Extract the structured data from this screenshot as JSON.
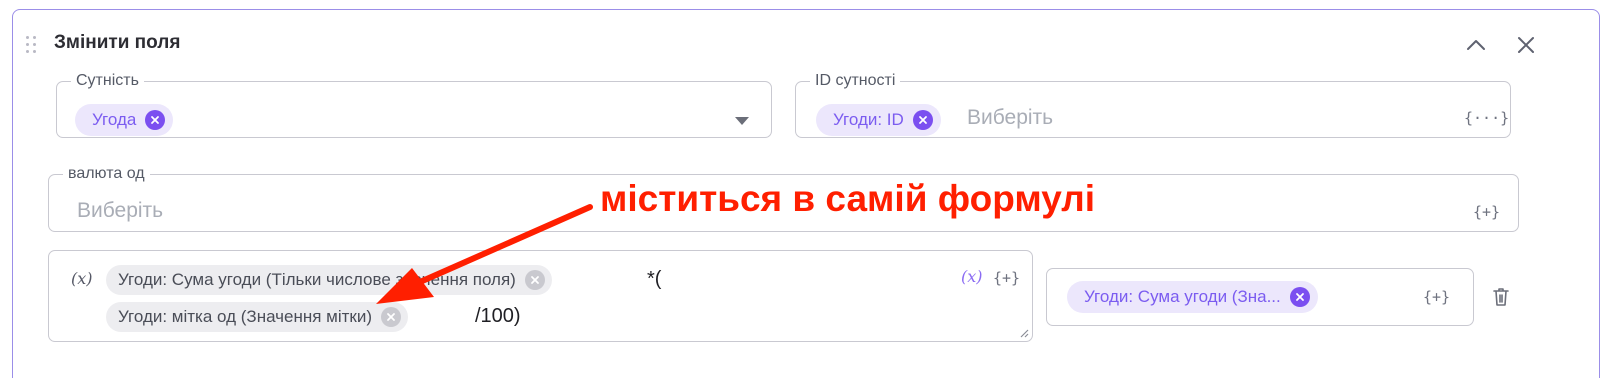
{
  "panel": {
    "title": "Змінити поля",
    "collapse_icon": "chevron-up-icon",
    "close_icon": "close-icon",
    "drag_icon": "drag-handle-icon"
  },
  "entity_field": {
    "label": "Сутність",
    "chip": "Угода",
    "dropdown_icon": "caret-down-icon"
  },
  "entity_id_field": {
    "label": "ID сутності",
    "chip": "Угоди: ID",
    "placeholder": "Виберіть",
    "insert_label": "{···}"
  },
  "currency_field": {
    "label": "валюта од",
    "placeholder": "Виберіть",
    "insert_label": "{+}"
  },
  "formula": {
    "fx_label": "(x)",
    "chip1": "Угоди: Сума угоди (Тільки числове значення поля)",
    "op1": "*(",
    "chip2": "Угоди: мітка од (Значення мітки)",
    "op2": "/100)",
    "fx_button": "(x)",
    "insert_label": "{+}"
  },
  "target_field": {
    "chip": "Угоди: Сума угоди (Зна...",
    "insert_label": "{+}",
    "delete_icon": "trash-icon"
  },
  "annotation": {
    "text": "міститься в самій формулі",
    "color": "#ff1f00"
  },
  "colors": {
    "accent": "#7b4ff0",
    "chip_bg": "#ece7fc",
    "panel_border": "#9b8ee8"
  }
}
